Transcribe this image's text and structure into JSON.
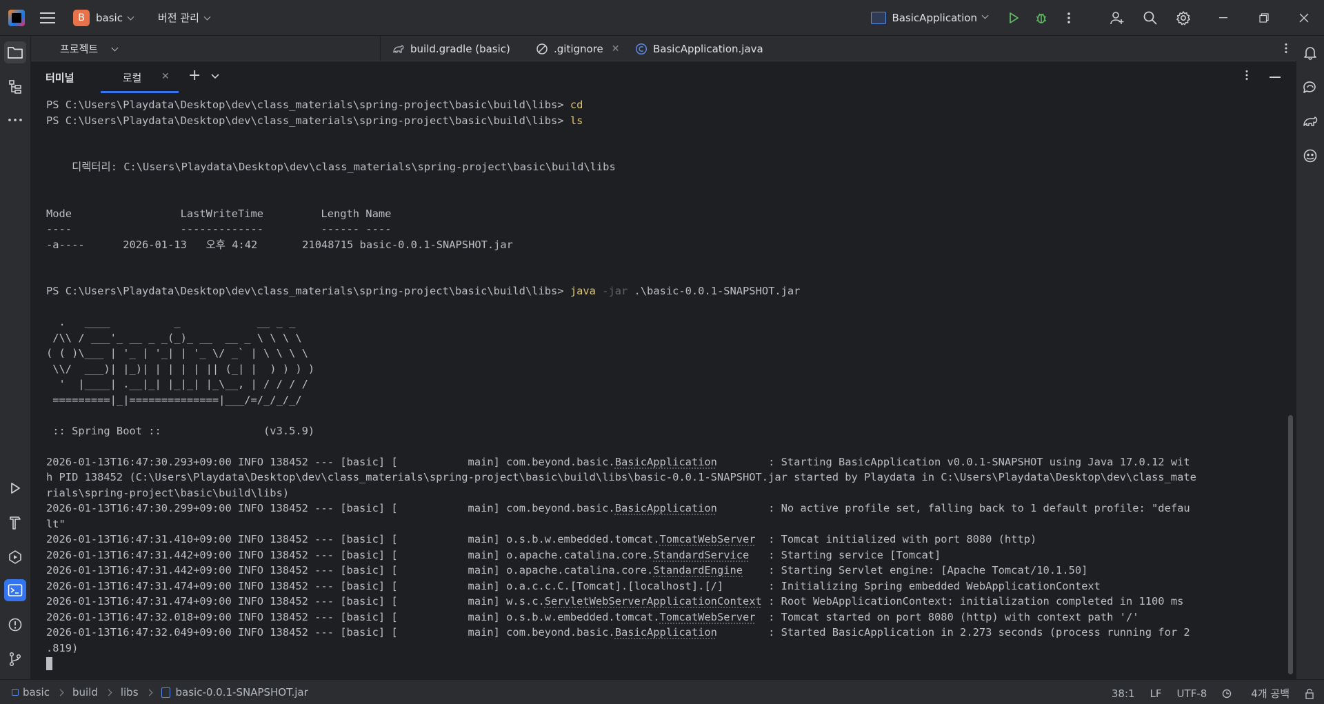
{
  "titlebar": {
    "project_letter": "B",
    "project_name": "basic",
    "vcs_label": "버전 관리",
    "run_config": "BasicApplication"
  },
  "project_panel": {
    "title": "프로젝트"
  },
  "editor_tabs": [
    {
      "label": "build.gradle (basic)",
      "icon": "gradle-icon"
    },
    {
      "label": ".gitignore",
      "icon": "ignore-file-icon"
    },
    {
      "label": "BasicApplication.java",
      "icon": "java-class-icon"
    }
  ],
  "terminal": {
    "title": "터미널",
    "tab_label": "로컬",
    "prompt": "PS C:\\Users\\Playdata\\Desktop\\dev\\class_materials\\spring-project\\basic\\build\\libs>",
    "cmd_cd": "cd",
    "cmd_ls": "ls",
    "dir_line": "    디렉터리: C:\\Users\\Playdata\\Desktop\\dev\\class_materials\\spring-project\\basic\\build\\libs",
    "table_header": "Mode                 LastWriteTime         Length Name",
    "table_rule": "----                 -------------         ------ ----",
    "table_row": "-a----      2026-01-13   오후 4:42       21048715 basic-0.0.1-SNAPSHOT.jar",
    "cmd_java": "java",
    "cmd_java_flag": "-jar",
    "cmd_java_arg": ".\\basic-0.0.1-SNAPSHOT.jar",
    "banner": [
      "  .   ____          _            __ _ _",
      " /\\\\ / ___'_ __ _ _(_)_ __  __ _ \\ \\ \\ \\",
      "( ( )\\___ | '_ | '_| | '_ \\/ _` | \\ \\ \\ \\",
      " \\\\/  ___)| |_)| | | | | || (_| |  ) ) ) )",
      "  '  |____| .__|_| |_|_| |_\\__, | / / / /",
      " =========|_|==============|___/=/_/_/_/"
    ],
    "boot_line": " :: Spring Boot ::                (v3.5.9)",
    "log_prefix": " INFO 138452 --- [basic] [           main] ",
    "logs": [
      {
        "time": "2026-01-13T16:47:30.293+09:00",
        "pkg": "com.beyond.basic.",
        "cls": "BasicApplication",
        "pad": "        ",
        "msg": ": Starting BasicApplication v0.0.1-SNAPSHOT using Java 17.0.12 wit",
        "wrap": [
          "h PID 138452 (C:\\Users\\Playdata\\Desktop\\dev\\class_materials\\spring-project\\basic\\build\\libs\\basic-0.0.1-SNAPSHOT.jar started by Playdata in C:\\Users\\Playdata\\Desktop\\dev\\class_mate",
          "rials\\spring-project\\basic\\build\\libs)"
        ]
      },
      {
        "time": "2026-01-13T16:47:30.299+09:00",
        "pkg": "com.beyond.basic.",
        "cls": "BasicApplication",
        "pad": "        ",
        "msg": ": No active profile set, falling back to 1 default profile: \"defau",
        "wrap": [
          "lt\""
        ]
      },
      {
        "time": "2026-01-13T16:47:31.410+09:00",
        "pkg": "o.s.b.w.embedded.tomcat.",
        "cls": "TomcatWebServer",
        "pad": "  ",
        "msg": ": Tomcat initialized with port 8080 (http)",
        "wrap": []
      },
      {
        "time": "2026-01-13T16:47:31.442+09:00",
        "pkg": "o.apache.catalina.core.",
        "cls": "StandardService",
        "pad": "   ",
        "msg": ": Starting service [Tomcat]",
        "wrap": []
      },
      {
        "time": "2026-01-13T16:47:31.442+09:00",
        "pkg": "o.apache.catalina.core.",
        "cls": "StandardEngine",
        "pad": "    ",
        "msg": ": Starting Servlet engine: [Apache Tomcat/10.1.50]",
        "wrap": []
      },
      {
        "time": "2026-01-13T16:47:31.474+09:00",
        "pkg": "o.a.c.c.C.[Tomcat].[localhost].[/]",
        "cls": "",
        "pad": "       ",
        "msg": ": Initializing Spring embedded WebApplicationContext",
        "wrap": []
      },
      {
        "time": "2026-01-13T16:47:31.474+09:00",
        "pkg": "w.s.c.",
        "cls": "ServletWebServerApplicationContext",
        "pad": " ",
        "msg": ": Root WebApplicationContext: initialization completed in 1100 ms",
        "wrap": []
      },
      {
        "time": "2026-01-13T16:47:32.018+09:00",
        "pkg": "o.s.b.w.embedded.tomcat.",
        "cls": "TomcatWebServer",
        "pad": "  ",
        "msg": ": Tomcat started on port 8080 (http) with context path '/'",
        "wrap": []
      },
      {
        "time": "2026-01-13T16:47:32.049+09:00",
        "pkg": "com.beyond.basic.",
        "cls": "BasicApplication",
        "pad": "        ",
        "msg": ": Started BasicApplication in 2.273 seconds (process running for 2",
        "wrap": [
          ".819)"
        ]
      }
    ]
  },
  "statusbar": {
    "breadcrumbs": [
      "basic",
      "build",
      "libs",
      "basic-0.0.1-SNAPSHOT.jar"
    ],
    "position": "38:1",
    "line_sep": "LF",
    "encoding": "UTF-8",
    "indent": "4개 공백"
  },
  "colors": {
    "accent": "#3574f0",
    "run_green": "#5fb865",
    "command_yellow": "#e0c46c"
  }
}
